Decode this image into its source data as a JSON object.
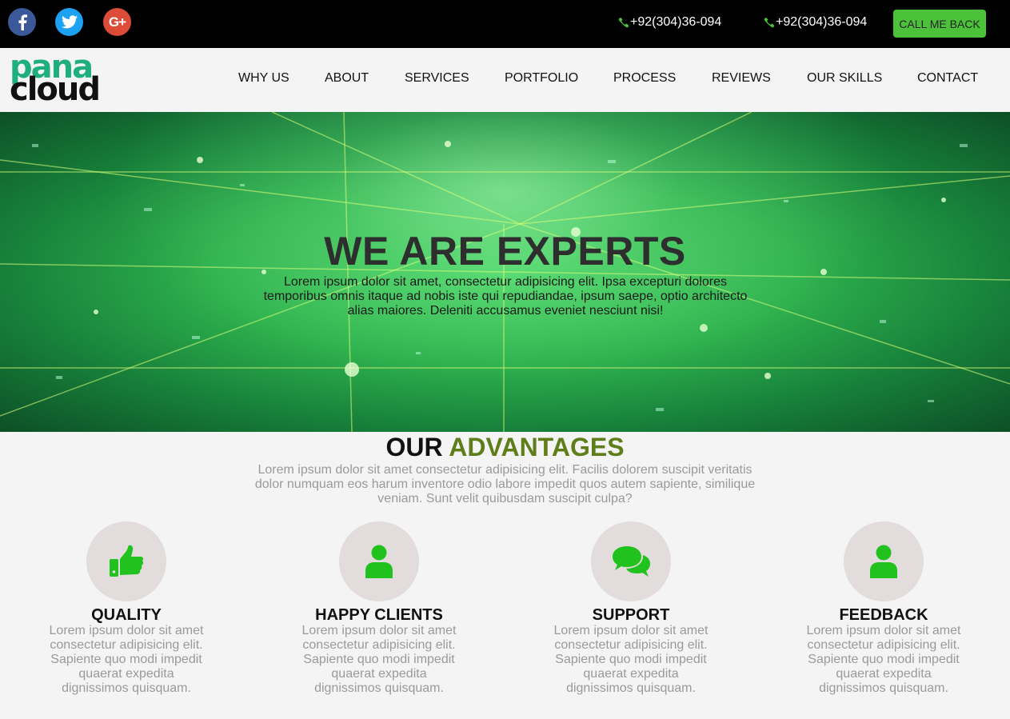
{
  "topbar": {
    "social": [
      {
        "name": "facebook",
        "icon": "facebook-icon"
      },
      {
        "name": "twitter",
        "icon": "twitter-icon"
      },
      {
        "name": "google-plus",
        "icon": "google-plus-icon",
        "glyph": "G+"
      }
    ],
    "phones": [
      "+92(304)36-094",
      "+92(304)36-094"
    ],
    "callback_label": "CALL ME BACK"
  },
  "navbar": {
    "logo": {
      "line1": "pana",
      "line2": "cloud"
    },
    "items": [
      "WHY US",
      "ABOUT",
      "SERVICES",
      "PORTFOLIO",
      "PROCESS",
      "REVIEWS",
      "OUR SKILLS",
      "CONTACT"
    ]
  },
  "hero": {
    "title": "WE ARE EXPERTS",
    "text": "Lorem ipsum dolor sit amet, consectetur adipisicing elit. Ipsa excepturi dolores temporibus omnis itaque ad nobis iste qui repudiandae, ipsum saepe, optio architecto alias maiores. Deleniti accusamus eveniet nesciunt nisi!"
  },
  "advantages": {
    "title_part1": "OUR",
    "title_part2": "ADVANTAGES",
    "text": "Lorem ipsum dolor sit amet consectetur adipisicing elit. Facilis dolorem suscipit veritatis dolor numquam eos harum inventore odio labore impedit quos autem sapiente, similique veniam. Sunt velit quibusdam suscipit culpa?",
    "features": [
      {
        "title": "QUALITY",
        "icon": "thumbs-up-icon",
        "text": "Lorem ipsum dolor sit amet consectetur adipisicing elit. Sapiente quo modi impedit quaerat expedita dignissimos quisquam."
      },
      {
        "title": "HAPPY CLIENTS",
        "icon": "user-icon",
        "text": "Lorem ipsum dolor sit amet consectetur adipisicing elit. Sapiente quo modi impedit quaerat expedita dignissimos quisquam."
      },
      {
        "title": "SUPPORT",
        "icon": "comments-icon",
        "text": "Lorem ipsum dolor sit amet consectetur adipisicing elit. Sapiente quo modi impedit quaerat expedita dignissimos quisquam."
      },
      {
        "title": "FEEDBACK",
        "icon": "user-icon",
        "text": "Lorem ipsum dolor sit amet consectetur adipisicing elit. Sapiente quo modi impedit quaerat expedita dignissimos quisquam."
      }
    ]
  },
  "colors": {
    "topbar_bg": "#000000",
    "accent_green": "#4cc23a",
    "icon_green": "#22c21e",
    "logo_green": "#1fae7f",
    "advantages_green": "#5e7e1a",
    "facebook": "#3b5998",
    "twitter": "#1da1f2",
    "google_plus": "#dd4b39"
  }
}
